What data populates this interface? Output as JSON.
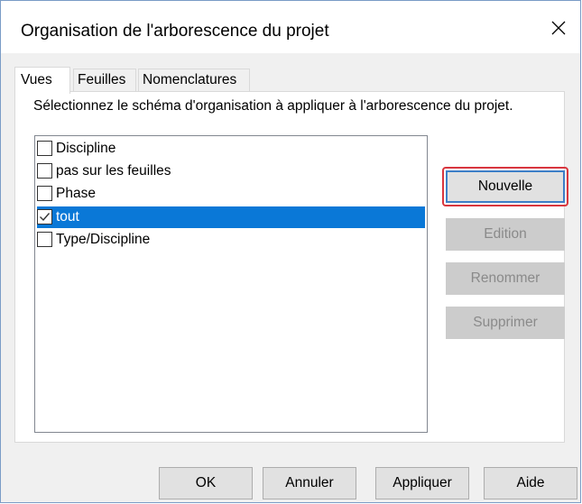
{
  "dialog": {
    "title": "Organisation de l'arborescence du projet",
    "close_icon": "close-icon"
  },
  "tabs": [
    {
      "label": "Vues",
      "active": true
    },
    {
      "label": "Feuilles",
      "active": false
    },
    {
      "label": "Nomenclatures",
      "active": false
    }
  ],
  "panel": {
    "instruction": "Sélectionnez le schéma d'organisation à appliquer à l'arborescence du projet.",
    "items": [
      {
        "label": "Discipline",
        "checked": false
      },
      {
        "label": "pas sur les feuilles",
        "checked": false
      },
      {
        "label": "Phase",
        "checked": false
      },
      {
        "label": "tout",
        "checked": true,
        "selected": true
      },
      {
        "label": "Type/Discipline",
        "checked": false
      }
    ]
  },
  "side_buttons": {
    "new": "Nouvelle",
    "edit": "Edition",
    "rename": "Renommer",
    "delete": "Supprimer"
  },
  "bottom_buttons": {
    "ok": "OK",
    "cancel": "Annuler",
    "apply": "Appliquer",
    "help": "Aide"
  },
  "colors": {
    "selection": "#0a78d7",
    "highlight_border": "#d9363e",
    "default_button_border": "#3c7fc8"
  }
}
